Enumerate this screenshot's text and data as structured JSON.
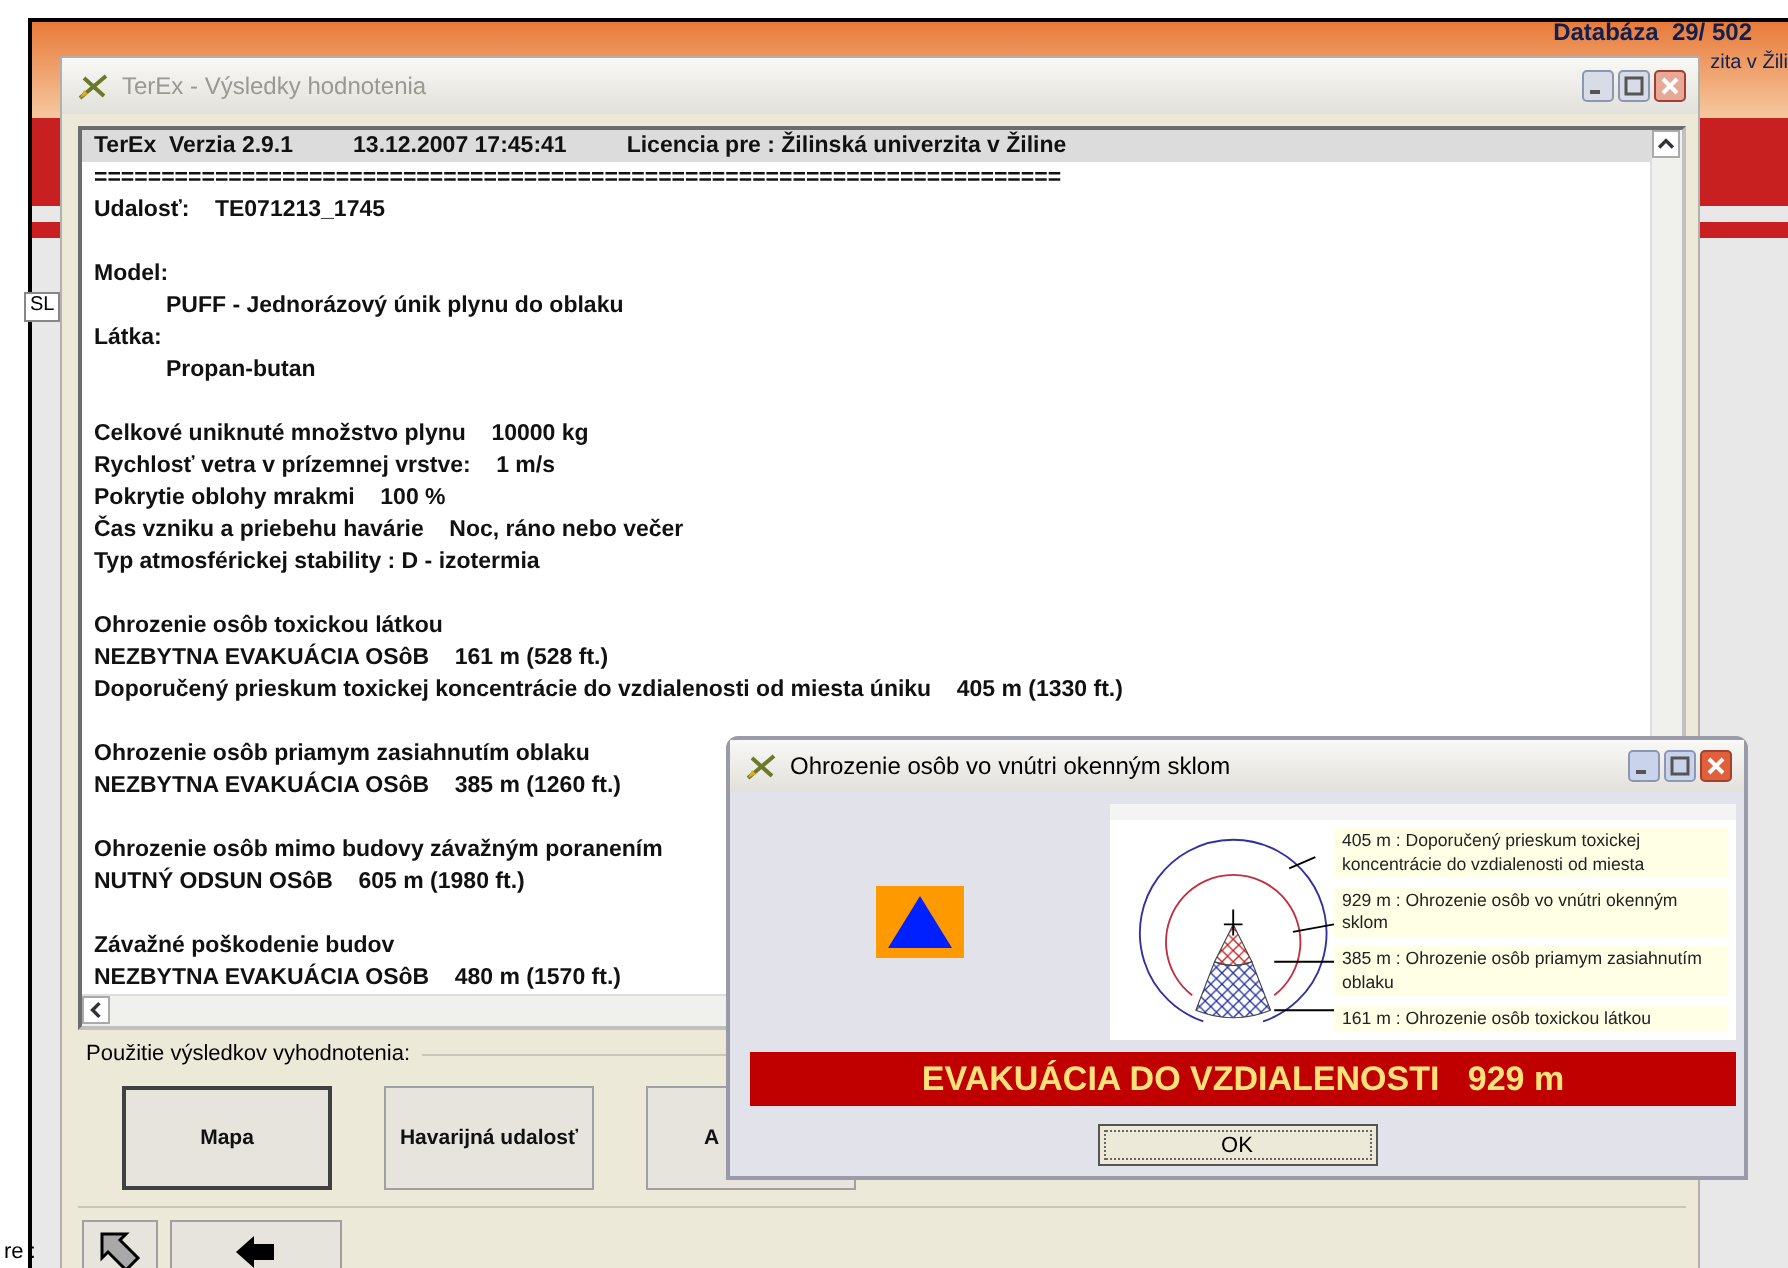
{
  "background": {
    "header_texts": [
      "Databáza  29/ 502",
      "zita v Žili"
    ],
    "field_value": "SL",
    "bottom_label": "re :"
  },
  "main_window": {
    "title": "TerEx - Výsledky hodnotenia",
    "report": {
      "header": [
        "TerEx  Verzia 2.9.1",
        "13.12.2007 17:45:41",
        "Licencia pre : Žilinská univerzita v Žiline"
      ],
      "separator": "========================================================================",
      "blocks": [
        [
          {
            "text": "Udalosť:    TE071213_1745"
          }
        ],
        [
          {
            "text": "Model:",
            "children": [
              {
                "text": "PUFF - Jednorázový únik plynu do oblaku"
              }
            ]
          },
          {
            "text": "Látka:",
            "children": [
              {
                "text": "Propan-butan"
              }
            ]
          }
        ],
        [
          {
            "text": "Celkové uniknuté množstvo plynu    10000 kg"
          },
          {
            "text": "Rychlosť vetra v prízemnej vrstve:    1 m/s"
          },
          {
            "text": "Pokrytie oblohy mrakmi    100 %"
          },
          {
            "text": "Čas vzniku a priebehu havárie    Noc, ráno nebo večer"
          },
          {
            "text": "Typ atmosférickej stability : D - izotermia"
          }
        ],
        [
          {
            "text": "Ohrozenie osôb toxickou látkou"
          },
          {
            "text": "NEZBYTNA EVAKUÁCIA OSôB    161 m (528 ft.)"
          },
          {
            "text": "Doporučený prieskum toxickej koncentrácie do vzdialenosti od miesta úniku    405 m (1330 ft.)"
          }
        ],
        [
          {
            "text": "Ohrozenie osôb priamym zasiahnutím oblaku"
          },
          {
            "text": "NEZBYTNA EVAKUÁCIA OSôB    385 m (1260 ft.)"
          }
        ],
        [
          {
            "text": "Ohrozenie osôb mimo budovy závažným poranením"
          },
          {
            "text": "NUTNÝ ODSUN OSôB    605 m (1980 ft.)"
          }
        ],
        [
          {
            "text": "Závažné poškodenie budov"
          },
          {
            "text": "NEZBYTNA EVAKUÁCIA OSôB    480 m (1570 ft.)"
          }
        ]
      ]
    },
    "usage_group": {
      "label": "Použitie výsledkov vyhodnotenia:",
      "buttons": [
        {
          "label": "Mapa",
          "default": true
        },
        {
          "label": "Havarijná udalosť",
          "default": false
        },
        {
          "label": "A",
          "default": false
        }
      ]
    }
  },
  "dialog": {
    "title": "Ohrozenie osôb vo vnútri okenným sklom",
    "legend": [
      {
        "text": "405 m : Doporučený prieskum toxickej koncentrácie do vzdialenosti od miesta"
      },
      {
        "text": "929 m : Ohrozenie osôb vo vnútri okenným sklom"
      },
      {
        "text": "385 m : Ohrozenie osôb priamym zasiahnutím oblaku"
      },
      {
        "text": "161 m : Ohrozenie osôb toxickou látkou"
      }
    ],
    "banner": "EVAKUÁCIA DO VZDIALENOSTI   929 m",
    "ok_button": "OK"
  }
}
